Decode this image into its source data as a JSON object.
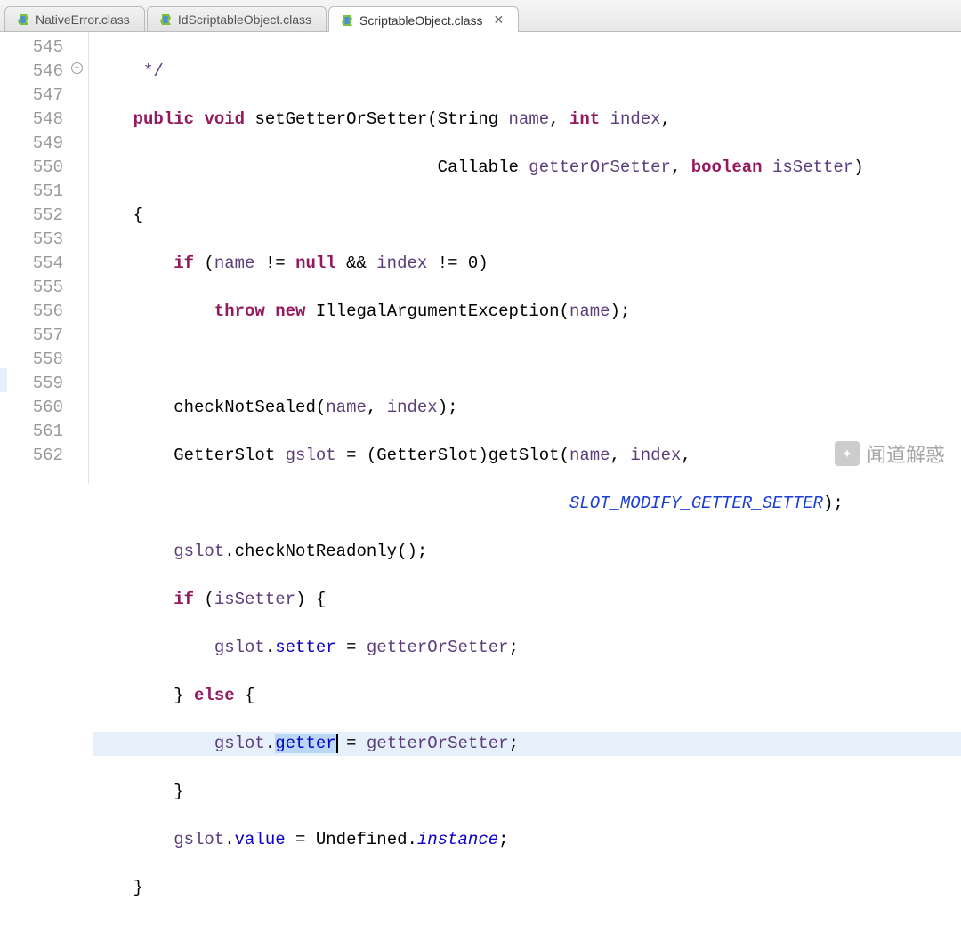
{
  "tabs": [
    {
      "label": "NativeError.class",
      "active": false
    },
    {
      "label": "IdScriptableObject.class",
      "active": false
    },
    {
      "label": "ScriptableObject.class",
      "active": true
    }
  ],
  "gutter": {
    "start": 545,
    "end": 562,
    "fold_at": 546
  },
  "highlight_line": 559,
  "code": {
    "l545_comment": "*/",
    "kw_public": "public",
    "kw_void": "void",
    "kw_int": "int",
    "kw_boolean": "boolean",
    "kw_if": "if",
    "kw_else": "else",
    "kw_throw": "throw",
    "kw_new": "new",
    "kw_null": "null",
    "method_decl": "setGetterOrSetter",
    "type_String": "String",
    "type_Callable": "Callable",
    "type_GetterSlot": "GetterSlot",
    "type_IAE": "IllegalArgumentException",
    "type_Undefined": "Undefined",
    "p_name": "name",
    "p_index": "index",
    "p_getterOrSetter": "getterOrSetter",
    "p_isSetter": "isSetter",
    "v_gslot": "gslot",
    "call_getSlot": "getSlot",
    "call_checkNotSealed": "checkNotSealed",
    "call_checkNotReadonly": "checkNotReadonly",
    "const_SLOT": "SLOT_MODIFY_GETTER_SETTER",
    "field_setter": "setter",
    "field_getter": "getter",
    "field_value": "value",
    "static_instance": "instance"
  },
  "watermark": {
    "text": "闻道解惑"
  }
}
